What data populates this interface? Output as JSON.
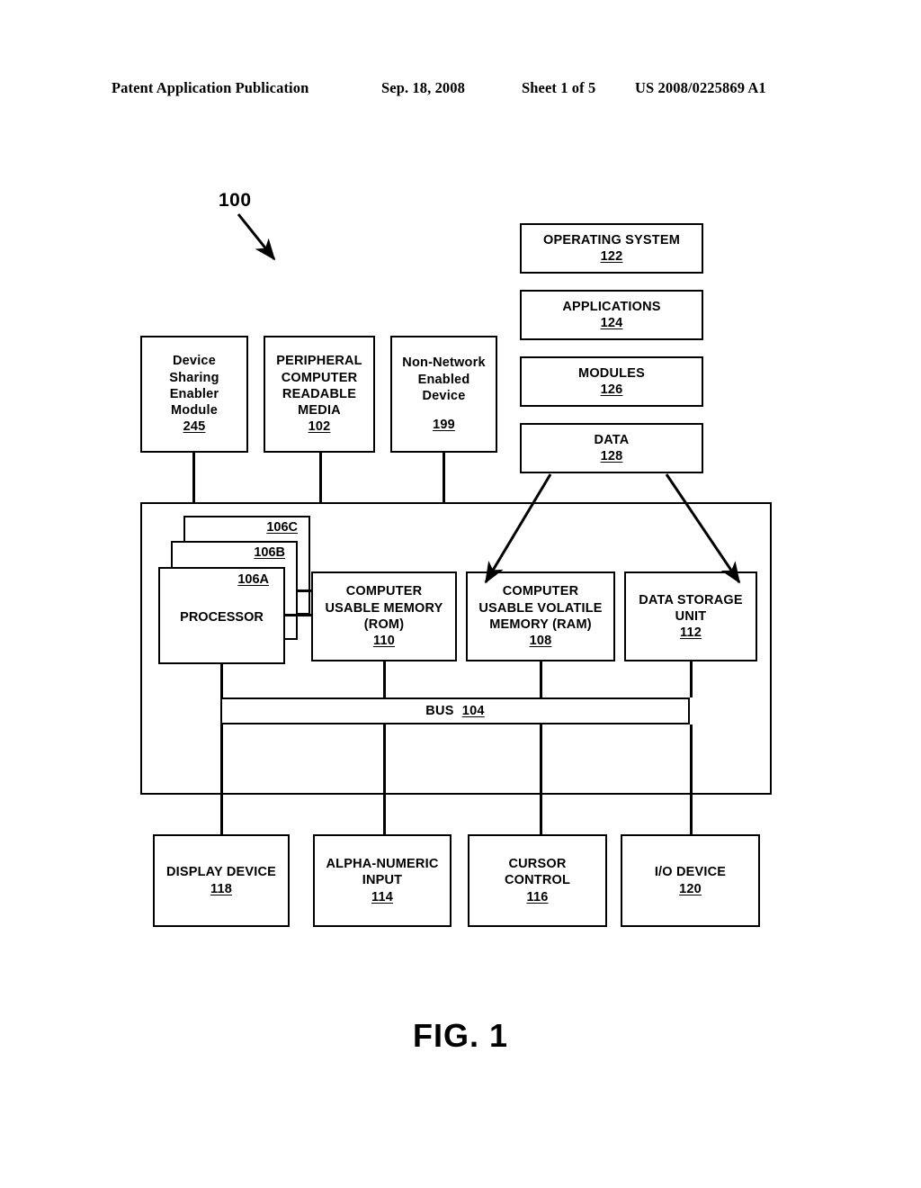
{
  "header": {
    "left": "Patent Application Publication",
    "date": "Sep. 18, 2008",
    "sheet": "Sheet 1 of 5",
    "publication_number": "US 2008/0225869 A1"
  },
  "figure": {
    "caption": "FIG. 1",
    "system_reference": "100"
  },
  "software_stack": [
    {
      "label": "OPERATING SYSTEM",
      "ref": "122"
    },
    {
      "label": "APPLICATIONS",
      "ref": "124"
    },
    {
      "label": "MODULES",
      "ref": "126"
    },
    {
      "label": "DATA",
      "ref": "128"
    }
  ],
  "external_devices": [
    {
      "label": "Device\nSharing\nEnabler\nModule",
      "ref": "245"
    },
    {
      "label": "PERIPHERAL\nCOMPUTER\nREADABLE\nMEDIA",
      "ref": "102"
    },
    {
      "label": "Non-Network\nEnabled\nDevice",
      "ref": "199"
    }
  ],
  "processor_stack": {
    "back_ref": "106C",
    "middle_ref": "106B",
    "front_ref": "106A",
    "front_label": "PROCESSOR"
  },
  "memory_row": [
    {
      "label": "COMPUTER\nUSABLE MEMORY\n(ROM)",
      "ref": "110"
    },
    {
      "label": "COMPUTER\nUSABLE VOLATILE\nMEMORY (RAM)",
      "ref": "108"
    },
    {
      "label": "DATA STORAGE\nUNIT",
      "ref": "112"
    }
  ],
  "bus": {
    "label": "BUS",
    "ref": "104"
  },
  "io_row": [
    {
      "label": "DISPLAY DEVICE",
      "ref": "118"
    },
    {
      "label": "ALPHA-NUMERIC\nINPUT",
      "ref": "114"
    },
    {
      "label": "CURSOR\nCONTROL",
      "ref": "116"
    },
    {
      "label": "I/O DEVICE",
      "ref": "120"
    }
  ],
  "colors": {
    "ink": "#000000",
    "paper": "#ffffff"
  }
}
